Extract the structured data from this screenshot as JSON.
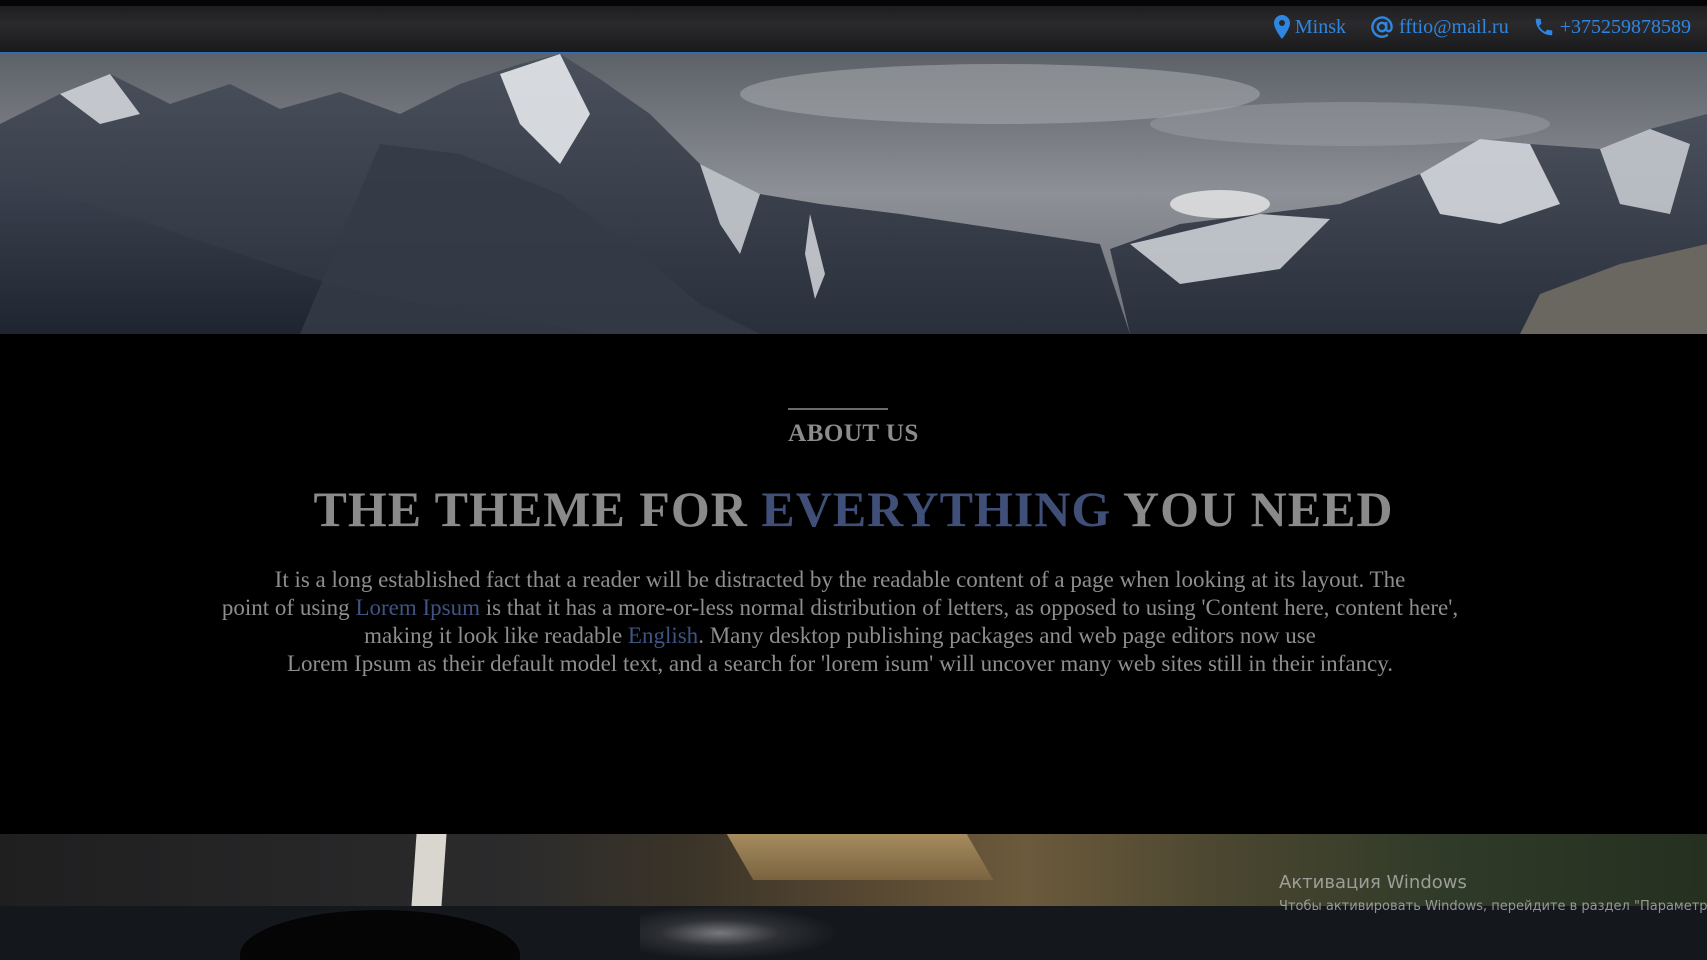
{
  "topbar": {
    "location": "Minsk",
    "email": "fftio@mail.ru",
    "phone": "+375259878589",
    "accent_color": "#2f86e0"
  },
  "icons": {
    "location": "map-pin-icon",
    "email": "at-sign-icon",
    "phone": "phone-icon"
  },
  "about": {
    "label": "ABOUT US",
    "heading_before": "THE THEME FOR ",
    "heading_accent": "EVERYTHING",
    "heading_after": " YOU NEED",
    "heading_accent_color": "#3f4f78",
    "text_1": "It is a long established fact that a reader will be distracted by the readable content of a page when looking at its layout. The",
    "text_2_before": "point of using ",
    "text_2_link": "Lorem Ipsum",
    "text_2_after": " is that it has a more-or-less normal distribution of letters, as opposed to using 'Content here, content here',",
    "text_3_before": "making it look like readable ",
    "text_3_link": "English",
    "text_3_after": ". Many desktop publishing packages and web page editors now use",
    "text_4": "Lorem Ipsum as their default model text, and a search for 'lorem isum' will uncover many web sites still in their infancy."
  },
  "watermark": {
    "title": "Активация Windows",
    "subtitle": "Чтобы активировать Windows, перейдите в раздел \"Параметр"
  }
}
